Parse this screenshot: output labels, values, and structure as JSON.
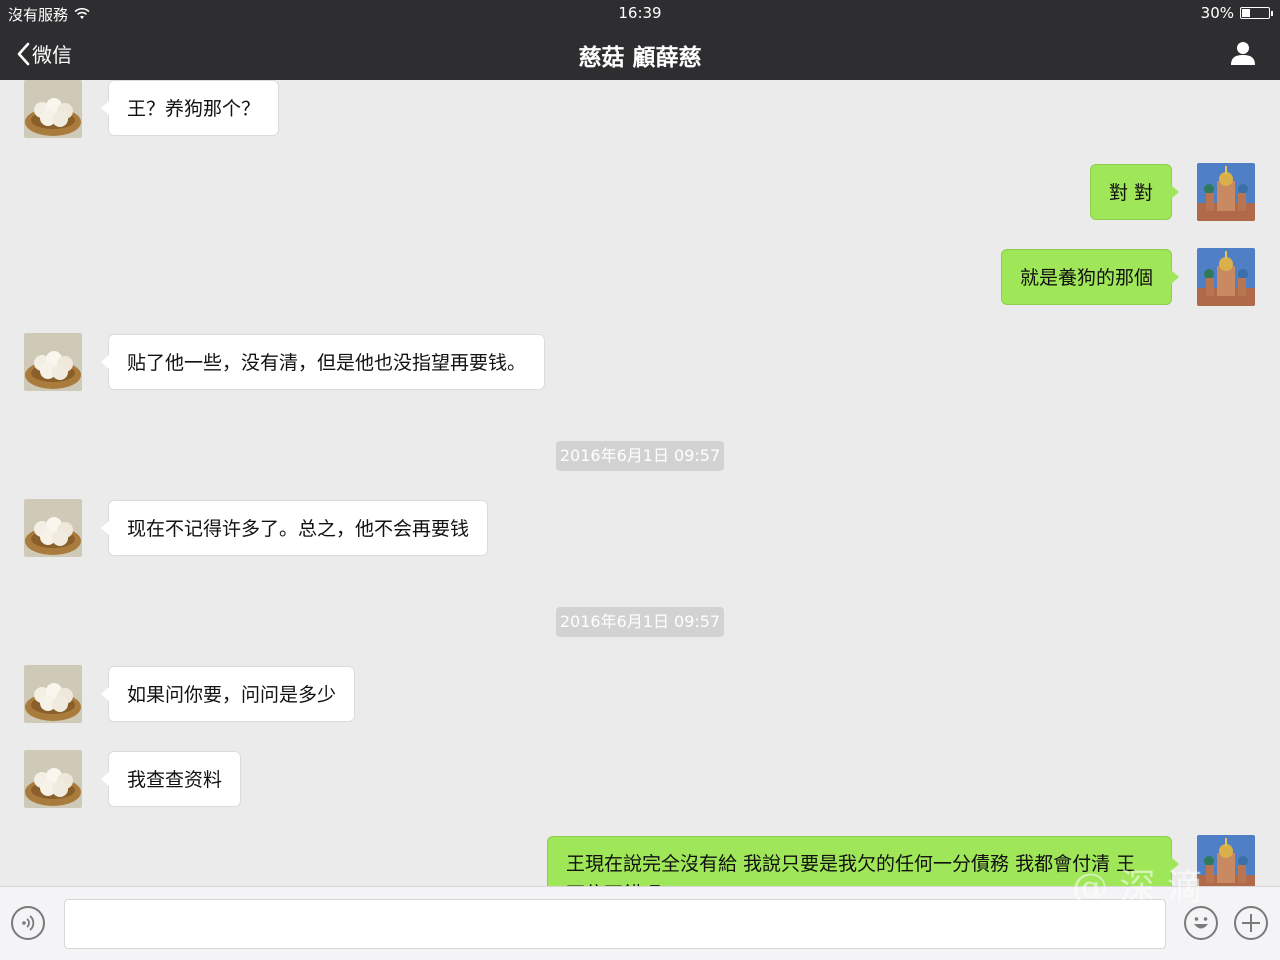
{
  "status_bar": {
    "carrier": "沒有服務",
    "wifi_icon": "wifi-icon",
    "time": "16:39",
    "battery_level": "30%",
    "battery_fraction": 0.3
  },
  "nav": {
    "back_label": "微信",
    "title": "慈菇 顧薛慈",
    "profile_icon": "person-icon"
  },
  "messages": [
    {
      "text": "王？养狗那个？"
    },
    {
      "text": "對 對"
    },
    {
      "text": "就是養狗的那個"
    },
    {
      "text": "贴了他一些，没有清，但是他也没指望再要钱。"
    },
    {
      "text": "2016年6月1日 09:57"
    },
    {
      "text": "现在不记得许多了。总之，他不会再要钱"
    },
    {
      "text": "2016年6月1日 09:57"
    },
    {
      "text": "如果问你要，问问是多少"
    },
    {
      "text": "我查查资料"
    },
    {
      "text": "王現在說完全沒有給 我說只要是我欠的任何一分債務 我都會付清 王不住不錯吧"
    }
  ],
  "input_bar": {
    "voice_icon": "voice-icon",
    "text_value": "",
    "emoji_icon": "emoji-icon",
    "add_icon": "plus-icon"
  },
  "watermark": "@ 深 滴",
  "colors": {
    "nav_bg": "#2e2e30",
    "chat_bg": "#ebebeb",
    "incoming_bubble": "#ffffff",
    "outgoing_bubble": "#9fe658",
    "timestamp_bg": "#d2d2d2"
  }
}
